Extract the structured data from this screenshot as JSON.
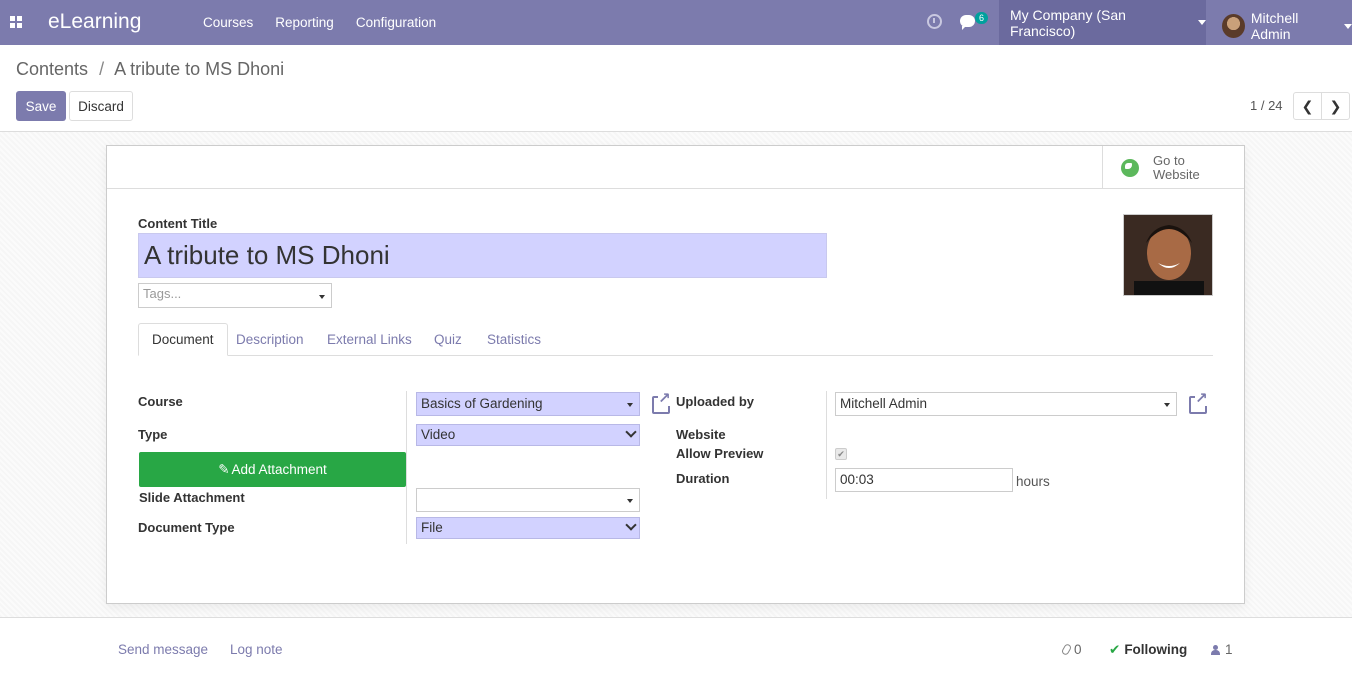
{
  "navbar": {
    "brand": "eLearning",
    "menu": [
      "Courses",
      "Reporting",
      "Configuration"
    ],
    "message_count": "6",
    "company": "My Company (San Francisco)",
    "user": "Mitchell Admin",
    "color": "#7c7bad"
  },
  "breadcrumb": {
    "parent": "Contents",
    "separator": "/",
    "current": "A tribute to MS Dhoni"
  },
  "toolbar": {
    "save_label": "Save",
    "discard_label": "Discard"
  },
  "pager": {
    "text": "1 / 24"
  },
  "button_box": {
    "goto_website": "Go to Website"
  },
  "form": {
    "title_label": "Content Title",
    "title_value": "A tribute to MS Dhoni",
    "tags_placeholder": "Tags...",
    "tabs": [
      "Document",
      "Description",
      "External Links",
      "Quiz",
      "Statistics"
    ],
    "active_tab": "Document",
    "left": {
      "course_label": "Course",
      "course_value": "Basics of Gardening",
      "type_label": "Type",
      "type_value": "Video",
      "add_attachment": "Add Attachment",
      "slide_attachment_label": "Slide Attachment",
      "slide_attachment_value": "",
      "document_type_label": "Document Type",
      "document_type_value": "File"
    },
    "right": {
      "uploaded_by_label": "Uploaded by",
      "uploaded_by_value": "Mitchell Admin",
      "website_label": "Website",
      "allow_preview_label": "Allow Preview",
      "allow_preview_checked": true,
      "duration_label": "Duration",
      "duration_value": "00:03",
      "duration_unit": "hours"
    }
  },
  "chatter": {
    "send_message": "Send message",
    "log_note": "Log note",
    "attachments": "0",
    "following": "Following",
    "followers": "1"
  }
}
